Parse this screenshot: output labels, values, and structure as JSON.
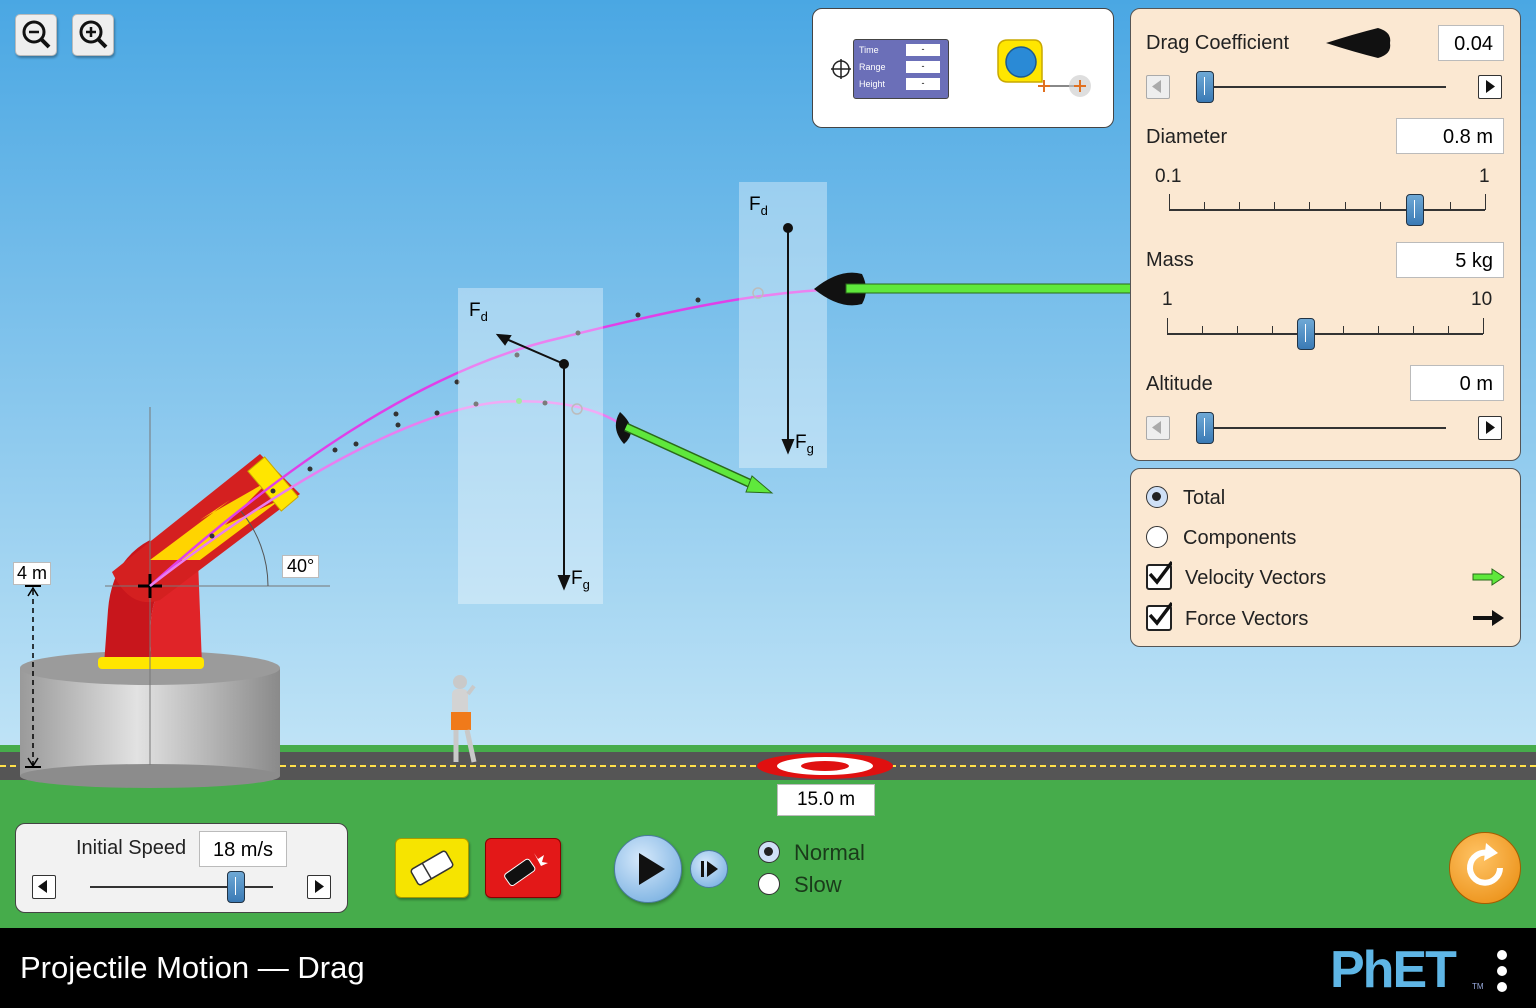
{
  "app": {
    "title": "Projectile Motion — Drag",
    "logo": "PhET",
    "trademark": "TM"
  },
  "zoom": {
    "out_icon": "zoom-out-icon",
    "in_icon": "zoom-in-icon"
  },
  "tools": {
    "datatool": {
      "rows": [
        "Time",
        "Range",
        "Height"
      ],
      "values": [
        "-",
        "-",
        "-"
      ]
    },
    "tape_icon": "tape-measure-icon"
  },
  "params": {
    "drag": {
      "label": "Drag Coefficient",
      "value": "0.04"
    },
    "diameter": {
      "label": "Diameter",
      "value": "0.8 m",
      "min": "0.1",
      "max": "1",
      "fraction": 0.78
    },
    "mass": {
      "label": "Mass",
      "value": "5 kg",
      "min": "1",
      "max": "10",
      "fraction": 0.44
    },
    "altitude": {
      "label": "Altitude",
      "value": "0 m"
    }
  },
  "options": {
    "total": "Total",
    "components": "Components",
    "selected": "Total",
    "velocity": {
      "label": "Velocity Vectors",
      "checked": true
    },
    "force": {
      "label": "Force Vectors",
      "checked": true
    }
  },
  "scene": {
    "height_label": "4 m",
    "angle_label": "40°",
    "target_label": "15.0 m",
    "force_labels": {
      "drag": "F",
      "drag_sub": "d",
      "gravity": "F",
      "gravity_sub": "g"
    }
  },
  "controls": {
    "speed_label": "Initial Speed",
    "speed_value": "18 m/s",
    "speed_fraction": 0.8,
    "normal": "Normal",
    "slow": "Slow",
    "speed_mode": "Normal"
  },
  "colors": {
    "sky": "#4aa7e3",
    "grass": "#46ac4b",
    "velocity": "#5fe83c",
    "trajectory": "#e040e8",
    "panel": "#fbe8d2",
    "cannon": "#d42020"
  }
}
